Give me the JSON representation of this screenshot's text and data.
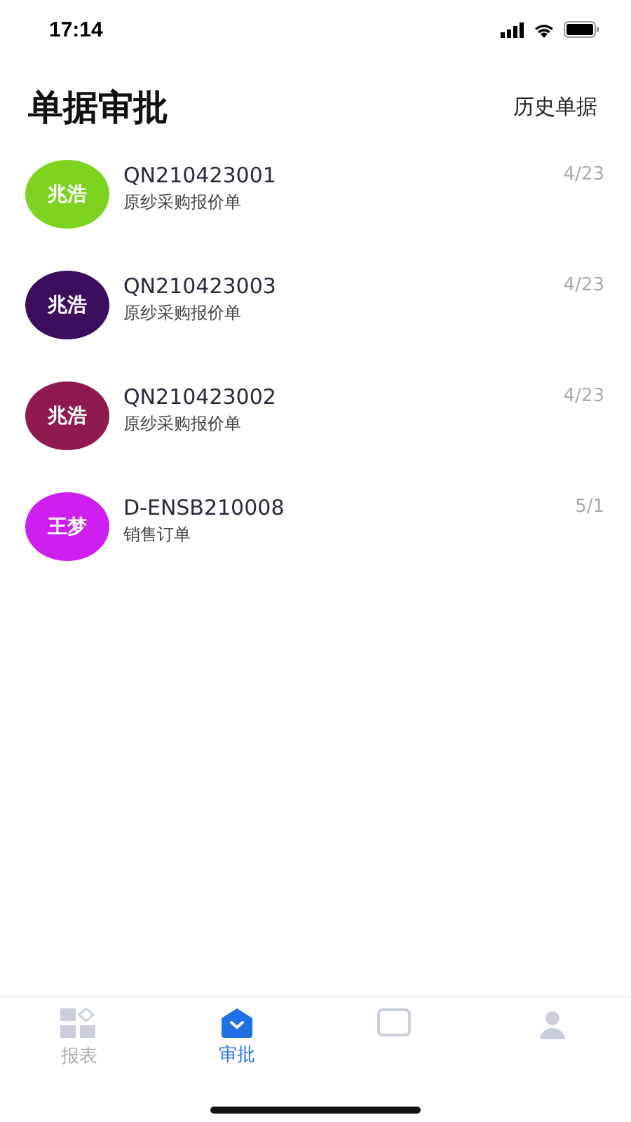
{
  "status_bar": {
    "time": "17:14"
  },
  "header": {
    "title": "单据审批",
    "action": "历史单据"
  },
  "items": [
    {
      "avatar": "兆浩",
      "color": "#7ed321",
      "number": "QN210423001",
      "type": "原纱采购报价单",
      "date": "4/23"
    },
    {
      "avatar": "兆浩",
      "color": "#3b0f5e",
      "number": "QN210423003",
      "type": "原纱采购报价单",
      "date": "4/23"
    },
    {
      "avatar": "兆浩",
      "color": "#8e1a4f",
      "number": "QN210423002",
      "type": "原纱采购报价单",
      "date": "4/23"
    },
    {
      "avatar": "王梦",
      "color": "#cc1ff0",
      "number": "D-ENSB210008",
      "type": "销售订单",
      "date": "5/1"
    }
  ],
  "tab_bar": [
    {
      "label": "报表",
      "selected": false
    },
    {
      "label": "审批",
      "selected": true
    },
    {
      "selected": false
    },
    {
      "selected": false
    }
  ]
}
